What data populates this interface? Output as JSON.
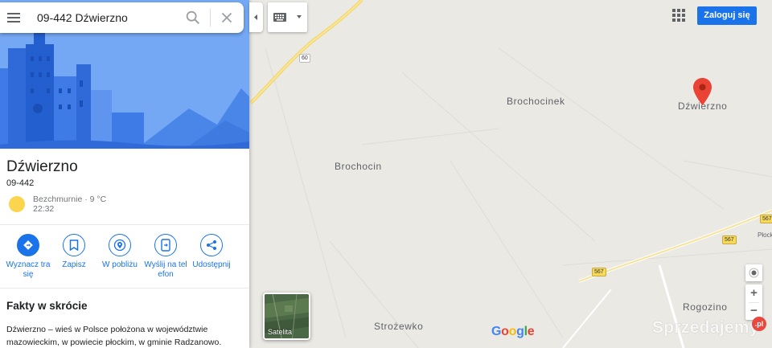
{
  "search": {
    "value": "09-442 Dźwierzno"
  },
  "place": {
    "title": "Dźwierzno",
    "postal": "09-442",
    "weather": "Bezchmurnie · 9 °C",
    "time": "22:32"
  },
  "actions": [
    {
      "label": "Wyznacz tra się",
      "icon": "directions-icon"
    },
    {
      "label": "Zapisz",
      "icon": "bookmark-icon"
    },
    {
      "label": "W pobliżu",
      "icon": "nearby-icon"
    },
    {
      "label": "Wyślij na tel efon",
      "icon": "send-to-phone-icon"
    },
    {
      "label": "Udostępnij",
      "icon": "share-icon"
    }
  ],
  "facts": {
    "title": "Fakty w skrócie",
    "text": "Dźwierzno – wieś w Polsce położona w województwie mazowieckim, w powiecie płockim, w gminie Radzanowo."
  },
  "header": {
    "signin_label": "Zaloguj się"
  },
  "map": {
    "places": [
      {
        "name": "Brochocinek"
      },
      {
        "name": "Dźwierzno"
      },
      {
        "name": "Brochocin"
      },
      {
        "name": "Rogozino"
      },
      {
        "name": "Strożewko"
      },
      {
        "name": "Płock"
      }
    ],
    "roads": [
      "60",
      "567",
      "567",
      "567"
    ],
    "satellite_label": "Satelita",
    "zoom_in": "+",
    "zoom_out": "−",
    "logo": "Google",
    "watermark": "Sprzedajemy",
    "watermark_badge": ".pl"
  },
  "colors": {
    "accent": "#1a73e8",
    "marker": "#ea4335",
    "sky": "#74a8f5",
    "map_bg": "#ebe9e4"
  }
}
